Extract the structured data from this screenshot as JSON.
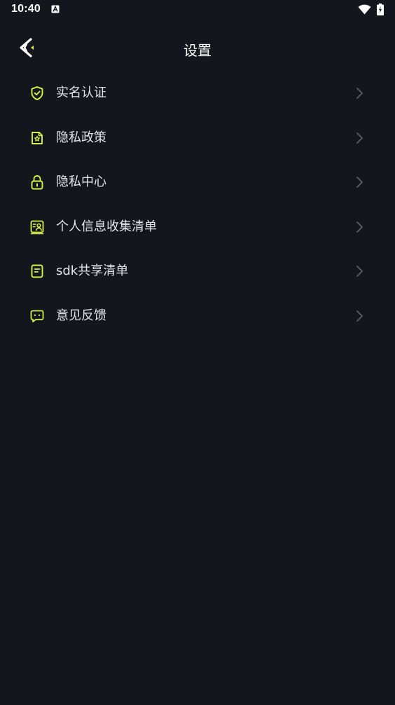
{
  "status_bar": {
    "time": "10:40",
    "notification_icon": "a-notification-icon",
    "wifi_icon": "wifi-icon",
    "battery_icon": "battery-charging-icon"
  },
  "header": {
    "title": "设置",
    "back_icon": "back-arrow-icon"
  },
  "colors": {
    "background": "#14161e",
    "accent": "#d8f043",
    "chevron": "#5c5f68",
    "text": "#e4e4e8"
  },
  "menu": {
    "items": [
      {
        "label": "实名认证",
        "icon": "shield-check-icon"
      },
      {
        "label": "隐私政策",
        "icon": "privacy-document-icon"
      },
      {
        "label": "隐私中心",
        "icon": "lock-icon"
      },
      {
        "label": "个人信息收集清单",
        "icon": "id-card-icon"
      },
      {
        "label": "sdk共享清单",
        "icon": "list-document-icon"
      },
      {
        "label": "意见反馈",
        "icon": "chat-bubble-icon"
      }
    ]
  }
}
